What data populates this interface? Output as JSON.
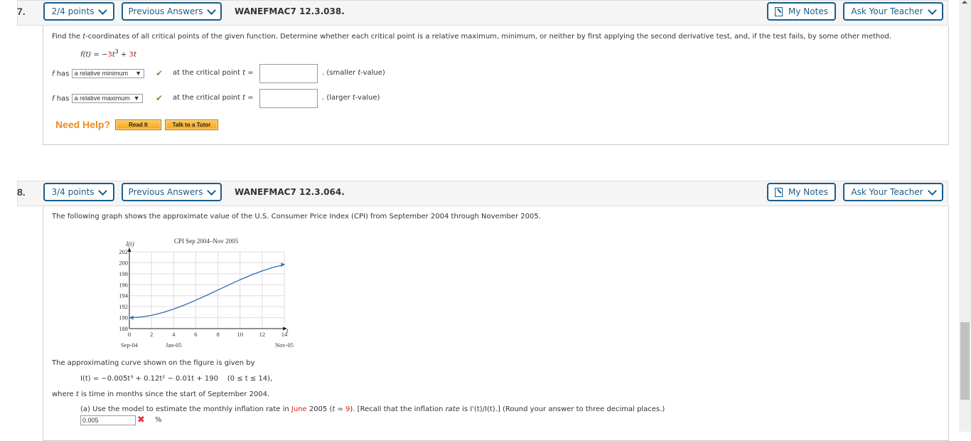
{
  "questions": [
    {
      "number": "7.",
      "points": "2/4 points",
      "previous_answers": "Previous Answers",
      "code": "WANEFMAC7 12.3.038.",
      "my_notes": "My Notes",
      "ask_teacher": "Ask Your Teacher",
      "prompt_parts": [
        "Find the ",
        "t",
        "-coordinates of all critical points of the given function. Determine whether each critical point is a relative maximum, minimum, or neither by first applying the second derivative test, and, if the test fails, by some other method."
      ],
      "function": {
        "lhs": "f(t) = −",
        "coef1": "3",
        "var1": "t",
        "exp1": "3",
        "plus": " + ",
        "coef2": "3",
        "var2": "t"
      },
      "rows": [
        {
          "prefix": "f",
          "has": " has ",
          "selected": "a relative minimum",
          "at": "at the critical point ",
          "tvar": "t",
          "eq": " =",
          "value": "",
          "suffix_pre": ". (smaller ",
          "suffix_t": "t",
          "suffix_post": "-value)"
        },
        {
          "prefix": "f",
          "has": " has ",
          "selected": "a relative maximum",
          "at": "at the critical point ",
          "tvar": "t",
          "eq": " =",
          "value": "",
          "suffix_pre": ". (larger ",
          "suffix_t": "t",
          "suffix_post": "-value)"
        }
      ],
      "need_help": "Need Help?",
      "read_it": "Read It",
      "talk_tutor": "Talk to a Tutor"
    },
    {
      "number": "8.",
      "points": "3/4 points",
      "previous_answers": "Previous Answers",
      "code": "WANEFMAC7 12.3.064.",
      "my_notes": "My Notes",
      "ask_teacher": "Ask Your Teacher",
      "intro": "The following graph shows the approximate value of the U.S. Consumer Price Index (CPI) from September 2004 through November 2005.",
      "curve_intro": "The approximating curve shown on the figure is given by",
      "formula": "I(t) = −0.005t³ + 0.12t² − 0.01t + 190",
      "domain": "(0 ≤ t ≤ 14),",
      "where_parts": [
        "where ",
        "t",
        " is time in months since the start of September 2004."
      ],
      "part_a": {
        "p1": "(a) Use the model to estimate the monthly inflation rate in ",
        "month": "June",
        "p2": " 2005 (",
        "t": "t",
        "p3": " = ",
        "tval": "9",
        "p4": "). [Recall that the inflation ",
        "rate": "rate",
        "p5": " is I'(t)/I(t).] (Round your answer to three decimal places.)",
        "answer": "0.005",
        "unit": "%"
      }
    }
  ],
  "chart_data": {
    "type": "line",
    "title": "CPI Sep 2004–Nov 2005",
    "ylabel": "I(t)",
    "xlabel": "t",
    "xlim": [
      0,
      14
    ],
    "ylim": [
      188,
      202
    ],
    "xticks": [
      0,
      2,
      4,
      6,
      8,
      10,
      12,
      14
    ],
    "yticks": [
      188,
      190,
      192,
      194,
      196,
      198,
      200,
      202
    ],
    "date_labels": [
      {
        "x": 0,
        "label": "Sep-04"
      },
      {
        "x": 4,
        "label": "Jan-05"
      },
      {
        "x": 14,
        "label": "Nov-05"
      }
    ],
    "grid": true,
    "series": [
      {
        "name": "I(t)",
        "x": [
          0,
          1,
          2,
          3,
          4,
          5,
          6,
          7,
          8,
          9,
          10,
          11,
          12,
          13,
          14
        ],
        "values": [
          190.0,
          190.105,
          190.42,
          190.915,
          191.56,
          192.325,
          193.18,
          194.095,
          195.04,
          195.985,
          196.9,
          197.755,
          198.52,
          199.165,
          199.66
        ]
      }
    ],
    "color": "#2a6fb5"
  },
  "colors": {
    "accent": "#1a5d8c",
    "orange": "#f08c1e",
    "error": "#e0353a",
    "check": "#5aa832"
  }
}
